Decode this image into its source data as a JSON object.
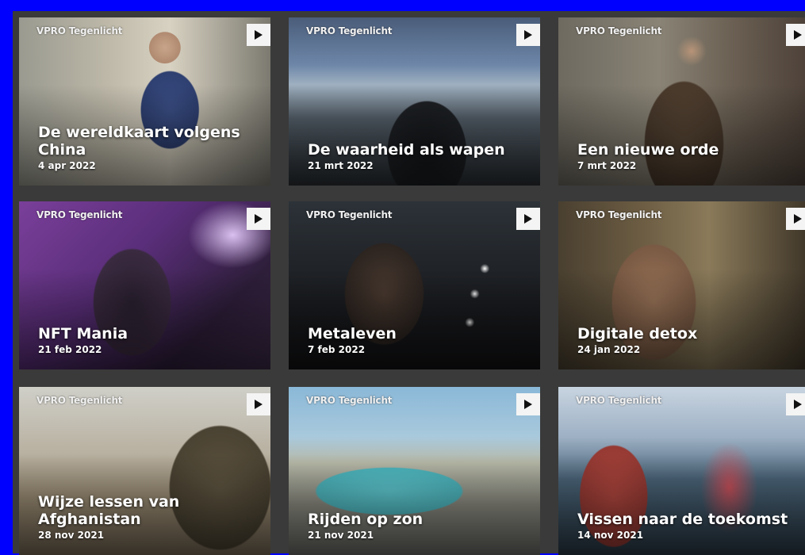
{
  "brand": "VPRO Tegenlicht",
  "cards": [
    {
      "title": "De wereldkaart volgens China",
      "date": "4 apr 2022"
    },
    {
      "title": "De waarheid als wapen",
      "date": "21 mrt 2022"
    },
    {
      "title": "Een nieuwe orde",
      "date": "7 mrt 2022"
    },
    {
      "title": "NFT Mania",
      "date": "21 feb 2022"
    },
    {
      "title": "Metaleven",
      "date": "7 feb 2022"
    },
    {
      "title": "Digitale detox",
      "date": "24 jan 2022"
    },
    {
      "title": "Wijze lessen van Afghanistan",
      "date": "28 nov 2021"
    },
    {
      "title": "Rijden op zon",
      "date": "21 nov 2021"
    },
    {
      "title": "Vissen naar de toekomst",
      "date": "14 nov 2021"
    }
  ],
  "icons": {
    "play": "play-icon"
  },
  "colors": {
    "page_background": "#0000ff",
    "frame_background": "#3a3a3a",
    "play_button": "#f4f4f4"
  }
}
